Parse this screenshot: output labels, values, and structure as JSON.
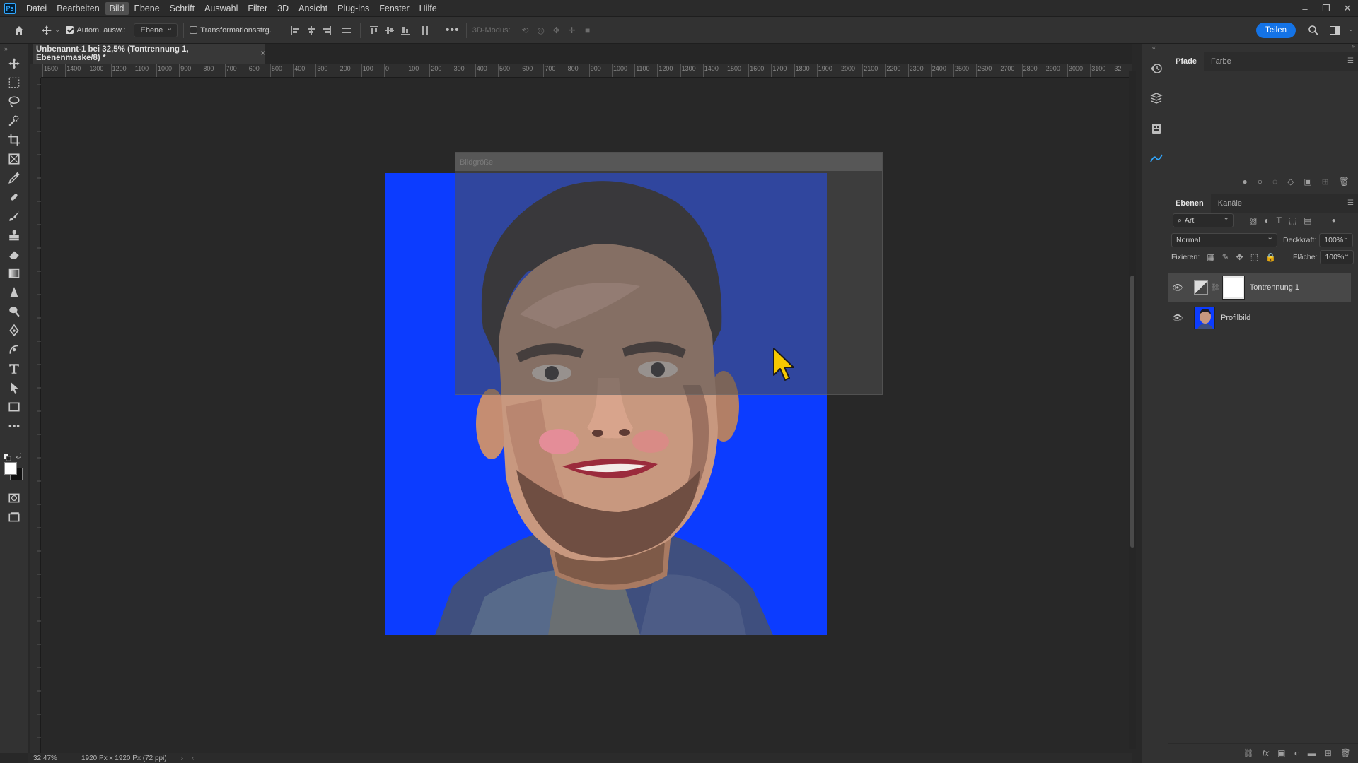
{
  "menu": {
    "logo": "Ps",
    "items": [
      "Datei",
      "Bearbeiten",
      "Bild",
      "Ebene",
      "Schrift",
      "Auswahl",
      "Filter",
      "3D",
      "Ansicht",
      "Plug-ins",
      "Fenster",
      "Hilfe"
    ],
    "active": "Bild"
  },
  "options": {
    "auto_select_label": "Autom. ausw.:",
    "auto_select_target": "Ebene",
    "transform_label": "Transformationsstrg.",
    "mode_3d_label": "3D-Modus:",
    "share_label": "Teilen"
  },
  "document": {
    "tab_title": "Unbenannt-1 bei 32,5% (Tontrennung 1, Ebenenmaske/8) *",
    "close": "×"
  },
  "ruler": {
    "top_ticks": [
      "1500",
      "1400",
      "1300",
      "1200",
      "1100",
      "1000",
      "900",
      "800",
      "700",
      "600",
      "500",
      "400",
      "300",
      "200",
      "100",
      "0",
      "100",
      "200",
      "300",
      "400",
      "500",
      "600",
      "700",
      "800",
      "900",
      "1000",
      "1100",
      "1200",
      "1300",
      "1400",
      "1500",
      "1600",
      "1700",
      "1800",
      "1900",
      "2000",
      "2100",
      "2200",
      "2300",
      "2400",
      "2500",
      "2600",
      "2700",
      "2800",
      "2900",
      "3000",
      "3100",
      "32"
    ]
  },
  "dialog": {
    "title": "Bildgröße"
  },
  "status": {
    "zoom": "32,47%",
    "doc_info": "1920 Px x 1920 Px (72 ppi)"
  },
  "panels": {
    "top_tabs": [
      "Pfade",
      "Farbe"
    ],
    "layers_tabs": [
      "Ebenen",
      "Kanäle"
    ],
    "filter_kind": "Art",
    "blend_mode": "Normal",
    "opacity_label": "Deckkraft:",
    "opacity_value": "100%",
    "lock_label": "Fixieren:",
    "fill_label": "Fläche:",
    "fill_value": "100%",
    "layers": [
      {
        "name": "Tontrennung 1",
        "selected": true
      },
      {
        "name": "Profilbild",
        "selected": false
      }
    ]
  },
  "colors": {
    "canvas_blue": "#0c3cff",
    "accent": "#1473e6",
    "cursor": "#f6c800"
  }
}
